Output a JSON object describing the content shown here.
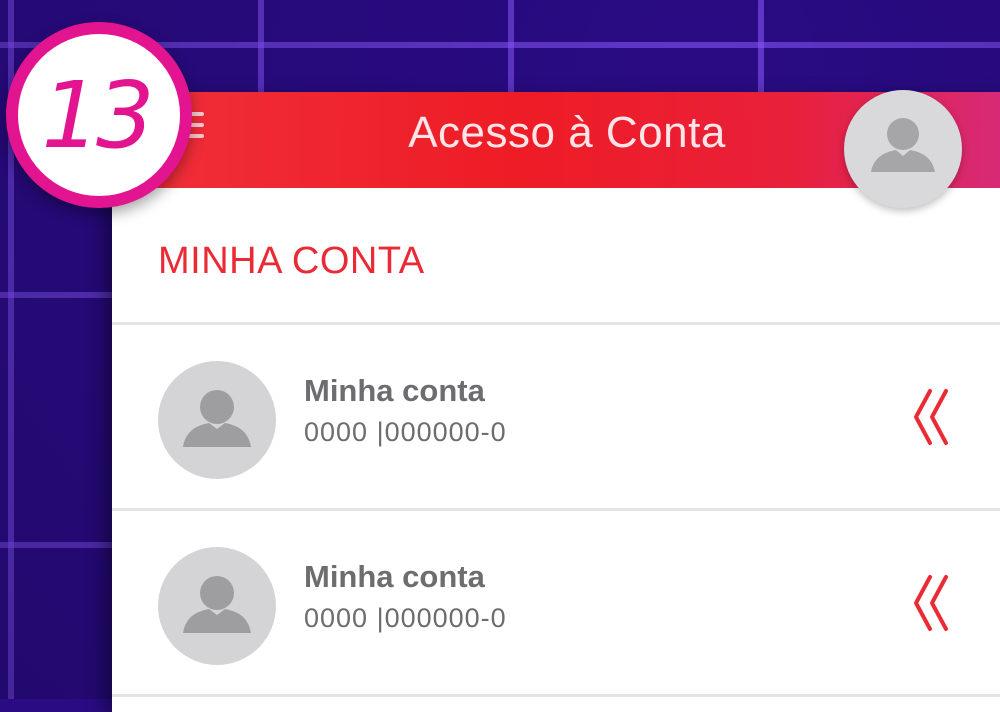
{
  "step_badge": {
    "number": "13",
    "color": "#e3148f"
  },
  "header": {
    "title": "Acesso à Conta",
    "menu_icon": "hamburger-menu-icon",
    "avatar_icon": "user-avatar-icon"
  },
  "section": {
    "title": "MINHA CONTA"
  },
  "accounts": [
    {
      "name": "Minha conta",
      "number": "0000 |000000-0",
      "icon": "user-avatar-icon",
      "action_icon": "double-chevron-left-icon"
    },
    {
      "name": "Minha conta",
      "number": "0000 |000000-0",
      "icon": "user-avatar-icon",
      "action_icon": "double-chevron-left-icon"
    }
  ],
  "colors": {
    "accent": "#ee1c25",
    "background": "#2a0b84",
    "text_muted": "#6d6d70"
  }
}
